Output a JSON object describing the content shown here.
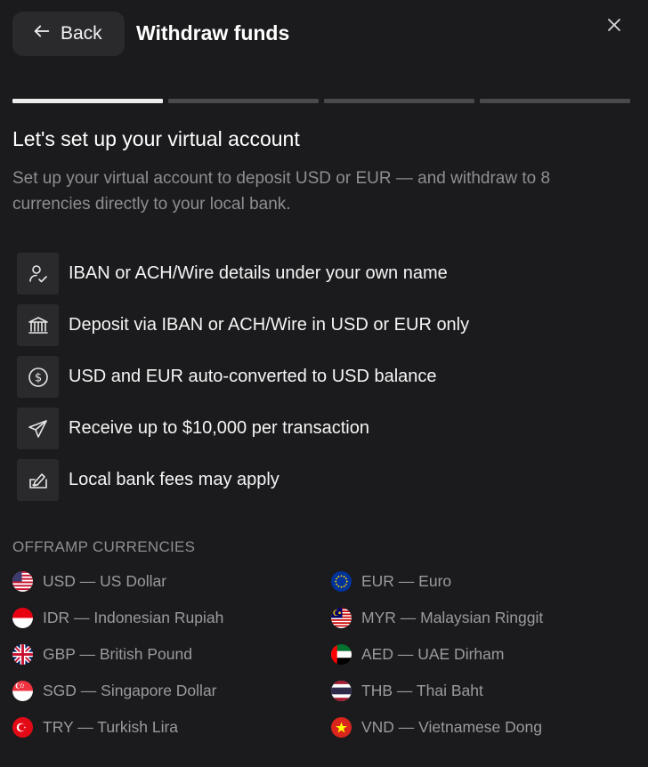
{
  "header": {
    "back_label": "Back",
    "title": "Withdraw funds",
    "close_icon": "close-icon"
  },
  "progress": {
    "total_steps": 4,
    "current_step": 1
  },
  "intro": {
    "heading": "Let's set up your virtual account",
    "description": "Set up your virtual account to deposit USD or EUR — and withdraw to 8 currencies directly to your local bank."
  },
  "features": [
    {
      "icon": "user-check-icon",
      "label": "IBAN or ACH/Wire details under your own name"
    },
    {
      "icon": "bank-icon",
      "label": "Deposit via IBAN or ACH/Wire in USD or EUR only"
    },
    {
      "icon": "dollar-circle-icon",
      "label": "USD and EUR auto-converted to USD balance"
    },
    {
      "icon": "send-icon",
      "label": "Receive up to $10,000 per transaction"
    },
    {
      "icon": "fee-icon",
      "label": "Local bank fees may apply"
    }
  ],
  "offramp": {
    "title": "OFFRAMP CURRENCIES",
    "currencies": [
      {
        "flag": "us-flag-icon",
        "label": "USD — US Dollar"
      },
      {
        "flag": "eu-flag-icon",
        "label": "EUR — Euro"
      },
      {
        "flag": "id-flag-icon",
        "label": "IDR — Indonesian Rupiah"
      },
      {
        "flag": "my-flag-icon",
        "label": "MYR — Malaysian Ringgit"
      },
      {
        "flag": "gb-flag-icon",
        "label": "GBP — British Pound"
      },
      {
        "flag": "ae-flag-icon",
        "label": "AED — UAE Dirham"
      },
      {
        "flag": "sg-flag-icon",
        "label": "SGD — Singapore Dollar"
      },
      {
        "flag": "th-flag-icon",
        "label": "THB — Thai Baht"
      },
      {
        "flag": "tr-flag-icon",
        "label": "TRY — Turkish Lira"
      },
      {
        "flag": "vn-flag-icon",
        "label": "VND — Vietnamese Dong"
      }
    ]
  },
  "colors": {
    "background": "#1b1b1d",
    "surface": "#2a2a2d",
    "muted_text": "#8e8e93",
    "progress_active": "#ececec",
    "progress_inactive": "#4a4a4e"
  }
}
